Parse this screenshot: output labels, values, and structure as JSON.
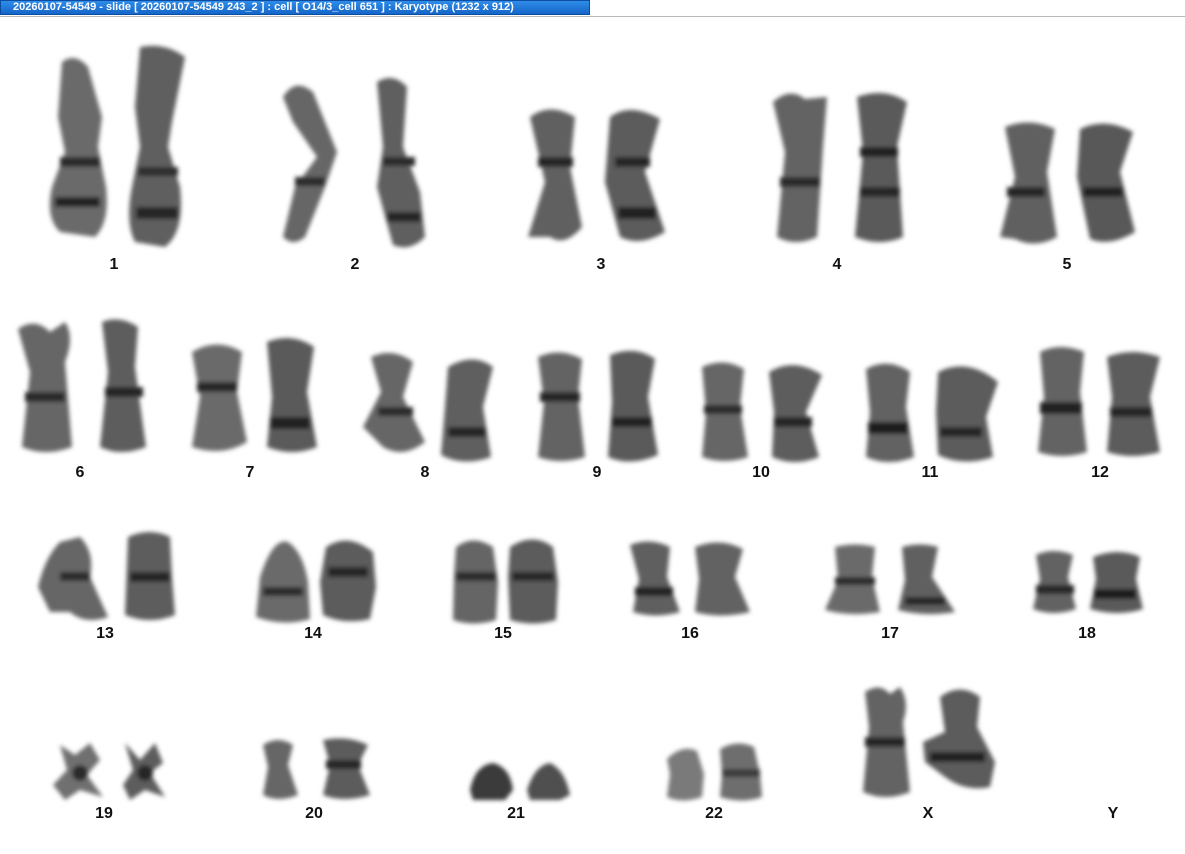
{
  "window": {
    "title": "20260107-54549 - slide [ 20260107-54549 243_2 ] : cell [ O14/3_cell 651 ] : Karyotype  (1232 x 912)"
  },
  "karyotype": {
    "labels": [
      "1",
      "2",
      "3",
      "4",
      "5",
      "6",
      "7",
      "8",
      "9",
      "10",
      "11",
      "12",
      "13",
      "14",
      "15",
      "16",
      "17",
      "18",
      "19",
      "20",
      "21",
      "22",
      "X",
      "Y"
    ]
  }
}
